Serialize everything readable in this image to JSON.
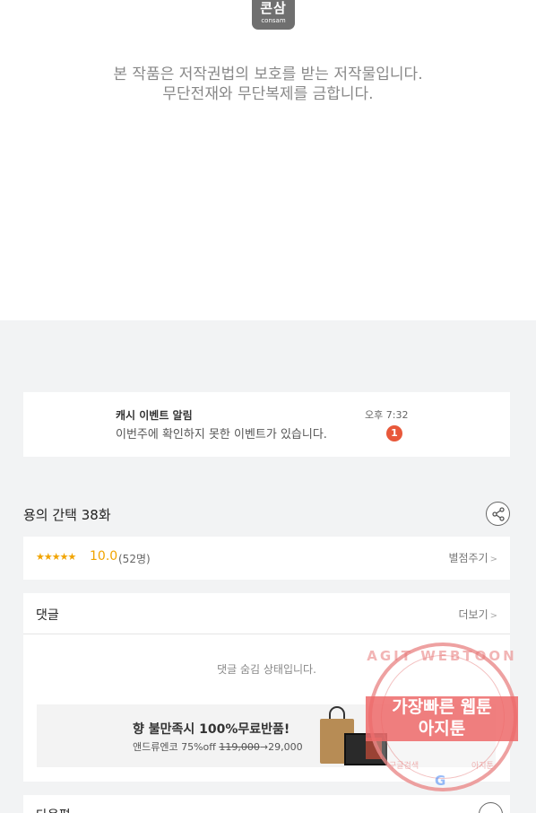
{
  "logo": {
    "text_ko": "콘삼",
    "text_en": "consam"
  },
  "copyright": {
    "line1": "본 작품은 저작권법의 보호를 받는 저작물입니다.",
    "line2": "무단전재와 무단복제를 금합니다."
  },
  "notice": {
    "title": "캐시 이벤트 알림",
    "text": "이번주에 확인하지 못한 이벤트가 있습니다.",
    "time": "오후 7:32",
    "badge": "1"
  },
  "episode": {
    "title": "용의 간택 38화",
    "share_icon": "share-icon"
  },
  "rating": {
    "stars": "★★★★★",
    "score": "10.0",
    "count": "(52명)",
    "rate_label": "별점주기"
  },
  "comments": {
    "title": "댓글",
    "more_label": "더보기",
    "status": "댓글 숨김 상태입니다."
  },
  "ad": {
    "headline": "향 불만족시 100%무료반품!",
    "brand_prefix": "앤드류엔코 75%off ",
    "original_price": "119,000",
    "arrow": "→",
    "sale_price": "29,000"
  },
  "next": {
    "title": "다음편"
  },
  "watermark": {
    "ring_text": "AGIT WEBTOON",
    "line1": "가장빠른 웹툰",
    "line2": "아지툰",
    "left_small": "구글검색",
    "right_small": "아지툰",
    "google": "G"
  },
  "colors": {
    "accent_star": "#f1a400",
    "badge": "#e8583a",
    "watermark": "#ed6868"
  }
}
